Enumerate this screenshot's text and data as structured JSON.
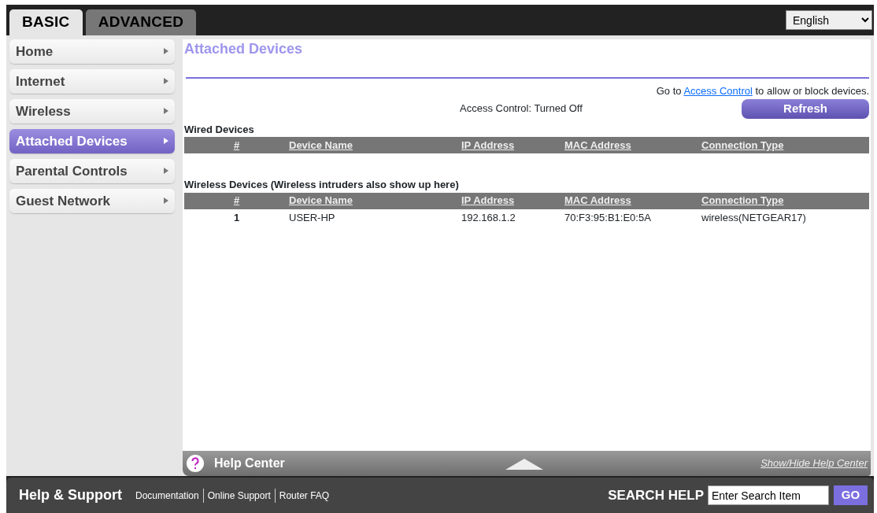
{
  "tabs": [
    {
      "label": "BASIC",
      "selected": true
    },
    {
      "label": "ADVANCED",
      "selected": false
    }
  ],
  "language": {
    "value": "English"
  },
  "sidebar": {
    "items": [
      {
        "label": "Home",
        "selected": false
      },
      {
        "label": "Internet",
        "selected": false
      },
      {
        "label": "Wireless",
        "selected": false
      },
      {
        "label": "Attached Devices",
        "selected": true
      },
      {
        "label": "Parental Controls",
        "selected": false
      },
      {
        "label": "Guest Network",
        "selected": false
      }
    ]
  },
  "page_title": "Attached Devices",
  "access_note": {
    "before": "Go to",
    "link": "Access Control",
    "after": "to allow or block devices."
  },
  "access_status": "Access Control: Turned Off",
  "refresh_button": "Refresh",
  "sections": [
    {
      "title": "Wired Devices",
      "columns": [
        "#",
        "Device Name",
        "IP Address",
        "MAC Address",
        "Connection Type"
      ]
    },
    {
      "title": "Wireless Devices (Wireless intruders also show up here)",
      "columns": [
        "#",
        "Device Name",
        "IP Address",
        "MAC Address",
        "Connection Type"
      ],
      "rows": [
        [
          "1",
          "USER-HP",
          "192.168.1.2",
          "70:F3:95:B1:E0:5A",
          "wireless(NETGEAR17)"
        ]
      ]
    }
  ],
  "help_center": {
    "title": "Help Center",
    "toggle": "Show/Hide Help Center"
  },
  "footer": {
    "title": "Help & Support",
    "links": [
      "Documentation",
      "Online Support",
      "Router FAQ"
    ],
    "search_label": "SEARCH HELP",
    "search_value": "Enter Search Item",
    "go_button": "GO"
  }
}
